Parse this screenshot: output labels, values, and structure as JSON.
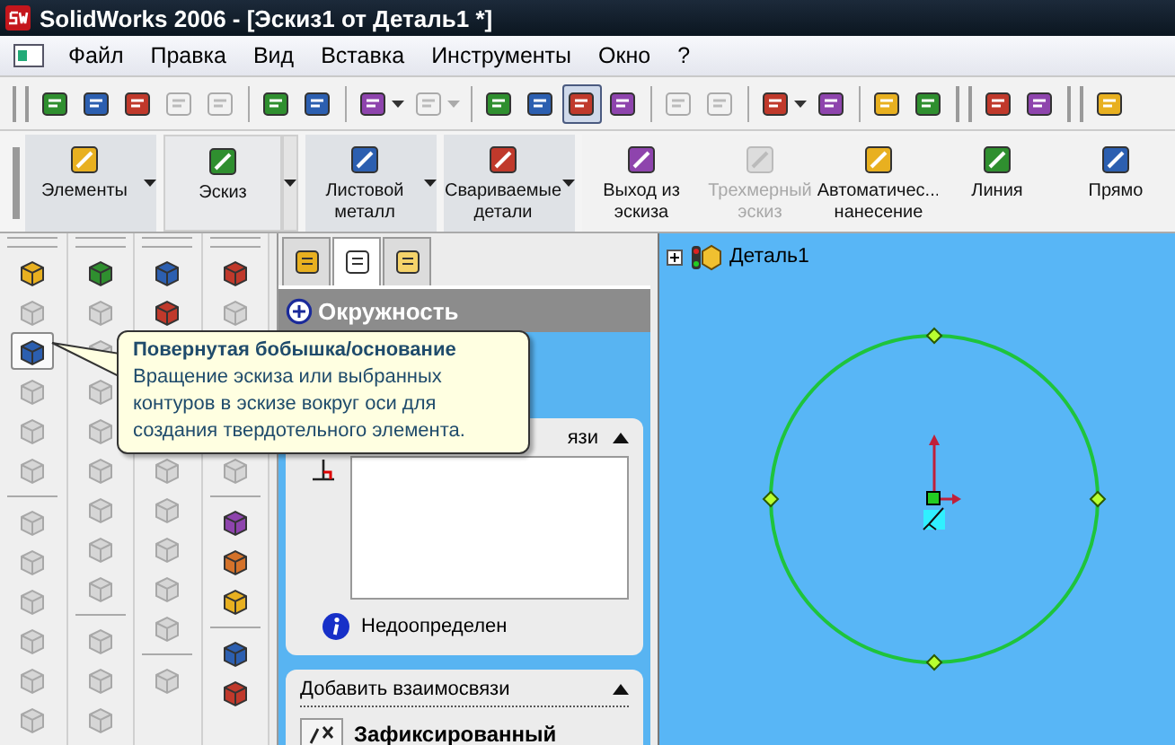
{
  "window": {
    "title": "SolidWorks 2006 - [Эскиз1 от Деталь1 *]"
  },
  "menu": [
    "Файл",
    "Правка",
    "Вид",
    "Вставка",
    "Инструменты",
    "Окно",
    "?"
  ],
  "toolbar": [
    {
      "kind": "grip"
    },
    {
      "kind": "button",
      "enabled": true,
      "selected": false
    },
    {
      "kind": "button",
      "enabled": true,
      "selected": false
    },
    {
      "kind": "button",
      "enabled": true,
      "selected": false
    },
    {
      "kind": "button",
      "enabled": false,
      "selected": false
    },
    {
      "kind": "button",
      "enabled": false,
      "selected": false
    },
    {
      "kind": "separator"
    },
    {
      "kind": "button",
      "enabled": true,
      "selected": false
    },
    {
      "kind": "button",
      "enabled": true,
      "selected": false
    },
    {
      "kind": "separator"
    },
    {
      "kind": "split",
      "enabled": true,
      "selected": false
    },
    {
      "kind": "split",
      "enabled": false,
      "selected": false
    },
    {
      "kind": "separator"
    },
    {
      "kind": "button",
      "enabled": true,
      "selected": false
    },
    {
      "kind": "button",
      "enabled": true,
      "selected": false
    },
    {
      "kind": "button",
      "enabled": true,
      "selected": true
    },
    {
      "kind": "button",
      "enabled": true,
      "selected": false
    },
    {
      "kind": "separator"
    },
    {
      "kind": "button",
      "enabled": false,
      "selected": false
    },
    {
      "kind": "button",
      "enabled": false,
      "selected": false
    },
    {
      "kind": "separator"
    },
    {
      "kind": "split",
      "enabled": true,
      "selected": false
    },
    {
      "kind": "button",
      "enabled": true,
      "selected": false
    },
    {
      "kind": "separator"
    },
    {
      "kind": "button",
      "enabled": true,
      "selected": false
    },
    {
      "kind": "button",
      "enabled": true,
      "selected": false
    },
    {
      "kind": "grip"
    },
    {
      "kind": "button",
      "enabled": true,
      "selected": false
    },
    {
      "kind": "button",
      "enabled": true,
      "selected": false
    },
    {
      "kind": "grip"
    },
    {
      "kind": "button",
      "enabled": true,
      "selected": false
    }
  ],
  "command_manager": [
    {
      "label": "Элементы",
      "enabled": true,
      "selected": false,
      "dropdown": true
    },
    {
      "label": "Эскиз",
      "enabled": true,
      "selected": true,
      "dropdown": true
    },
    {
      "label": "Листовой металл",
      "enabled": true,
      "selected": false,
      "dropdown": true
    },
    {
      "label": "Свариваемые детали",
      "enabled": true,
      "selected": false,
      "dropdown": true
    },
    {
      "label": "Выход из эскиза",
      "enabled": true,
      "selected": false,
      "dropdown": false
    },
    {
      "label": "Трехмерный эскиз",
      "enabled": false,
      "selected": false,
      "dropdown": false
    },
    {
      "label": "Автоматичес... нанесение",
      "enabled": true,
      "selected": false,
      "dropdown": false
    },
    {
      "label": "Линия",
      "enabled": true,
      "selected": false,
      "dropdown": false
    },
    {
      "label": "Прямо",
      "enabled": true,
      "selected": false,
      "dropdown": false
    }
  ],
  "tool_columns": [
    {
      "items": [
        {
          "kind": "icon",
          "enabled": true,
          "selected": false
        },
        {
          "kind": "icon",
          "enabled": false,
          "selected": false
        },
        {
          "kind": "icon",
          "enabled": true,
          "selected": true
        },
        {
          "kind": "icon",
          "enabled": false,
          "selected": false
        },
        {
          "kind": "icon",
          "enabled": false,
          "selected": false
        },
        {
          "kind": "icon",
          "enabled": false,
          "selected": false
        },
        {
          "kind": "separator"
        },
        {
          "kind": "icon",
          "enabled": false,
          "selected": false
        },
        {
          "kind": "icon",
          "enabled": false,
          "selected": false
        },
        {
          "kind": "icon",
          "enabled": false,
          "selected": false
        },
        {
          "kind": "icon",
          "enabled": false,
          "selected": false
        },
        {
          "kind": "icon",
          "enabled": false,
          "selected": false
        },
        {
          "kind": "icon",
          "enabled": false,
          "selected": false
        }
      ]
    },
    {
      "items": [
        {
          "kind": "icon",
          "enabled": true,
          "selected": false
        },
        {
          "kind": "icon",
          "enabled": false,
          "selected": false
        },
        {
          "kind": "icon",
          "enabled": false,
          "selected": false
        },
        {
          "kind": "icon",
          "enabled": false,
          "selected": false
        },
        {
          "kind": "icon",
          "enabled": false,
          "selected": false
        },
        {
          "kind": "icon",
          "enabled": false,
          "selected": false
        },
        {
          "kind": "icon",
          "enabled": false,
          "selected": false
        },
        {
          "kind": "icon",
          "enabled": false,
          "selected": false
        },
        {
          "kind": "icon",
          "enabled": false,
          "selected": false
        },
        {
          "kind": "separator"
        },
        {
          "kind": "icon",
          "enabled": false,
          "selected": false
        },
        {
          "kind": "icon",
          "enabled": false,
          "selected": false
        },
        {
          "kind": "icon",
          "enabled": false,
          "selected": false
        }
      ]
    },
    {
      "items": [
        {
          "kind": "icon",
          "enabled": true,
          "selected": false
        },
        {
          "kind": "icon",
          "enabled": true,
          "selected": false
        },
        {
          "kind": "covered"
        },
        {
          "kind": "covered"
        },
        {
          "kind": "covered"
        },
        {
          "kind": "icon",
          "enabled": false,
          "selected": false
        },
        {
          "kind": "icon",
          "enabled": false,
          "selected": false
        },
        {
          "kind": "icon",
          "enabled": false,
          "selected": false
        },
        {
          "kind": "icon",
          "enabled": false,
          "selected": false
        },
        {
          "kind": "icon",
          "enabled": false,
          "selected": false
        },
        {
          "kind": "separator"
        },
        {
          "kind": "icon",
          "enabled": false,
          "selected": false
        }
      ]
    },
    {
      "items": [
        {
          "kind": "icon",
          "enabled": true,
          "selected": false
        },
        {
          "kind": "icon",
          "enabled": false,
          "selected": false
        },
        {
          "kind": "covered"
        },
        {
          "kind": "covered"
        },
        {
          "kind": "covered"
        },
        {
          "kind": "icon",
          "enabled": false,
          "selected": false
        },
        {
          "kind": "separator"
        },
        {
          "kind": "icon",
          "enabled": true,
          "selected": false
        },
        {
          "kind": "icon",
          "enabled": true,
          "selected": false
        },
        {
          "kind": "icon",
          "enabled": true,
          "selected": false
        },
        {
          "kind": "separator"
        },
        {
          "kind": "icon",
          "enabled": true,
          "selected": false
        },
        {
          "kind": "icon",
          "enabled": true,
          "selected": false
        }
      ]
    }
  ],
  "property_manager": {
    "tabs": [
      {
        "selected": false
      },
      {
        "selected": true
      },
      {
        "selected": false
      }
    ],
    "title": "Окружность",
    "relations_group": {
      "title": "язи",
      "status": "Недоопределен"
    },
    "add_relations_group": {
      "title": "Добавить взаимосвязи",
      "items": [
        "Зафиксированный"
      ]
    }
  },
  "tree": {
    "root": "Деталь1",
    "expanded": false
  },
  "tooltip": {
    "title": "Повернутая бобышка/основание",
    "text": "Вращение эскиза или выбранных контуров в эскизе вокруг оси для создания твердотельного элемента."
  }
}
